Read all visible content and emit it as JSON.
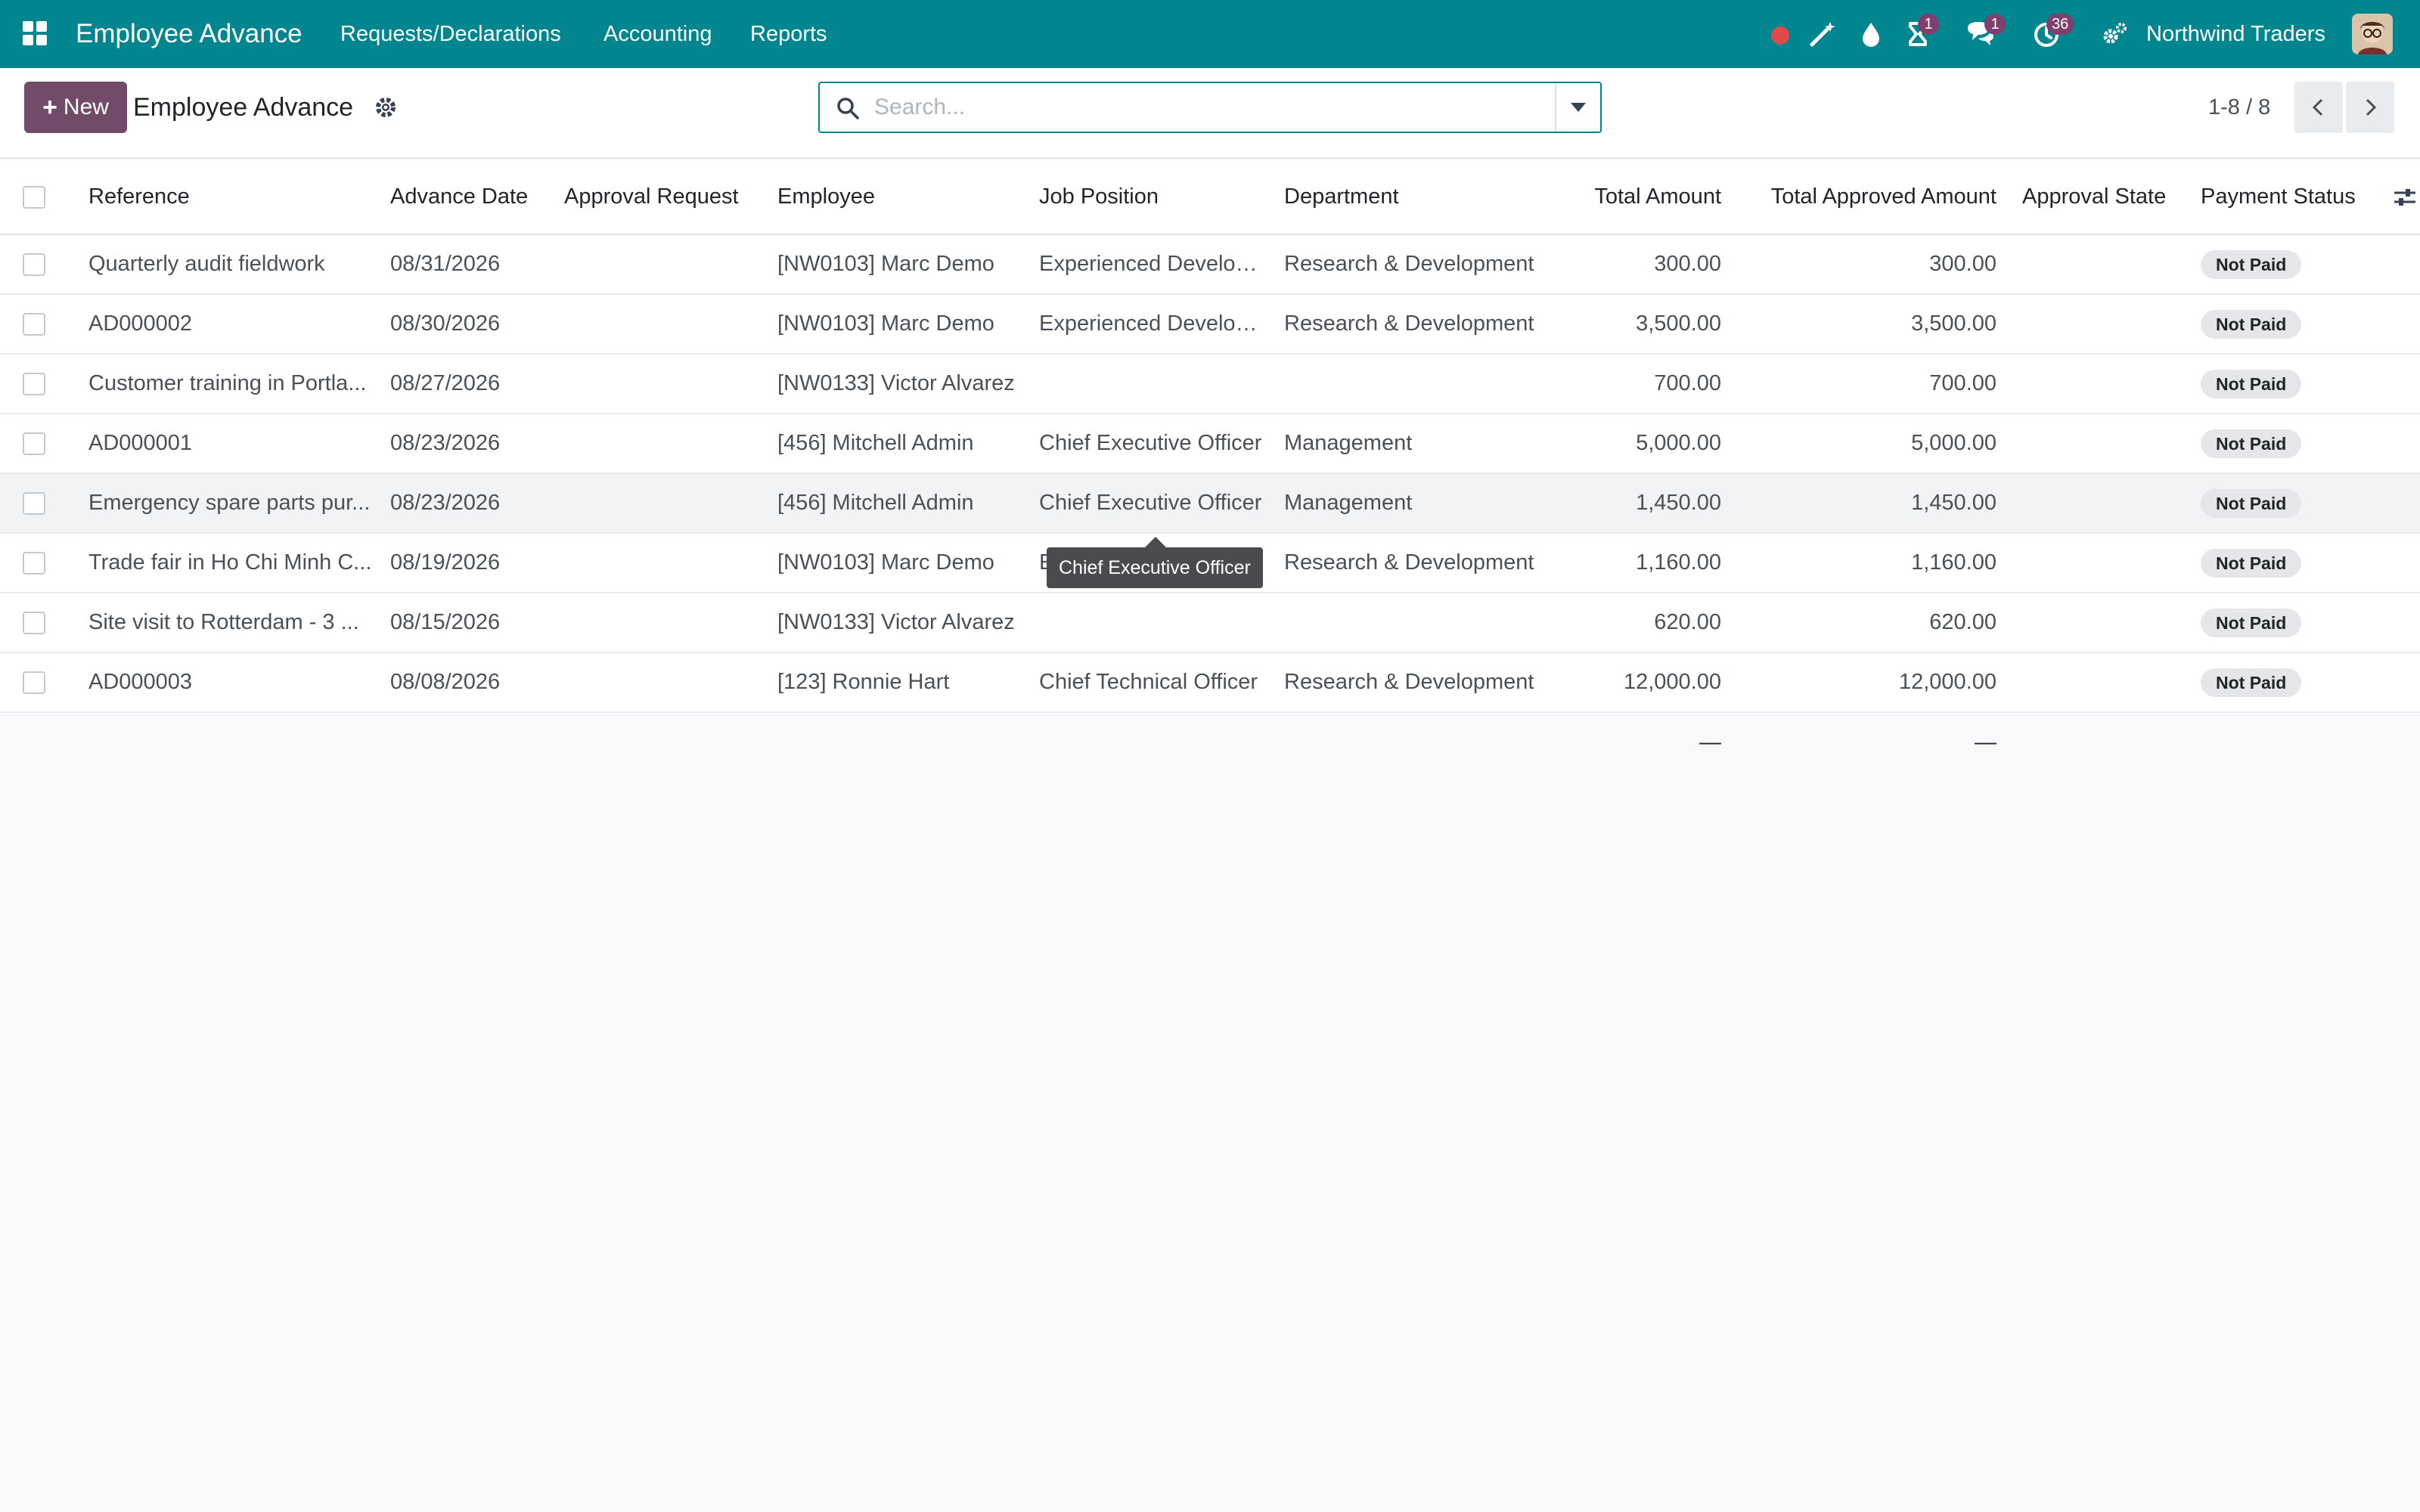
{
  "navbar": {
    "app_title": "Employee Advance",
    "menu": [
      "Requests/Declarations",
      "Accounting",
      "Reports"
    ],
    "activity_badge": "1",
    "messages_badge": "1",
    "clock_badge": "36",
    "company": "Northwind Traders",
    "bg_color": "#01858f"
  },
  "control_panel": {
    "new_label": "New",
    "title": "Employee Advance",
    "search_placeholder": "Search...",
    "pager": "1-8 / 8",
    "accent_color": "#714b67"
  },
  "table": {
    "columns": [
      "Reference",
      "Advance Date",
      "Approval Request",
      "Employee",
      "Job Position",
      "Department",
      "Total Amount",
      "Total Approved Amount",
      "Approval State",
      "Payment Status"
    ],
    "rows": [
      {
        "reference": "Quarterly audit fieldwork",
        "date": "08/31/2026",
        "approval_request": "",
        "employee": "[NW0103] Marc Demo",
        "job": "Experienced Developer",
        "department": "Research & Development",
        "total": "300.00",
        "approved": "300.00",
        "state": "",
        "payment": "Not Paid"
      },
      {
        "reference": "AD000002",
        "date": "08/30/2026",
        "approval_request": "",
        "employee": "[NW0103] Marc Demo",
        "job": "Experienced Developer",
        "department": "Research & Development",
        "total": "3,500.00",
        "approved": "3,500.00",
        "state": "",
        "payment": "Not Paid"
      },
      {
        "reference": "Customer training in Portla...",
        "date": "08/27/2026",
        "approval_request": "",
        "employee": "[NW0133] Victor Alvarez",
        "job": "",
        "department": "",
        "total": "700.00",
        "approved": "700.00",
        "state": "",
        "payment": "Not Paid"
      },
      {
        "reference": "AD000001",
        "date": "08/23/2026",
        "approval_request": "",
        "employee": "[456] Mitchell Admin",
        "job": "Chief Executive Officer",
        "department": "Management",
        "total": "5,000.00",
        "approved": "5,000.00",
        "state": "",
        "payment": "Not Paid"
      },
      {
        "reference": "Emergency spare parts pur...",
        "date": "08/23/2026",
        "approval_request": "",
        "employee": "[456] Mitchell Admin",
        "job": "Chief Executive Officer",
        "department": "Management",
        "total": "1,450.00",
        "approved": "1,450.00",
        "state": "",
        "payment": "Not Paid"
      },
      {
        "reference": "Trade fair in Ho Chi Minh C...",
        "date": "08/19/2026",
        "approval_request": "",
        "employee": "[NW0103] Marc Demo",
        "job": "Experienced Developer",
        "department": "Research & Development",
        "total": "1,160.00",
        "approved": "1,160.00",
        "state": "",
        "payment": "Not Paid"
      },
      {
        "reference": "Site visit to Rotterdam - 3 ...",
        "date": "08/15/2026",
        "approval_request": "",
        "employee": "[NW0133] Victor Alvarez",
        "job": "",
        "department": "",
        "total": "620.00",
        "approved": "620.00",
        "state": "",
        "payment": "Not Paid"
      },
      {
        "reference": "AD000003",
        "date": "08/08/2026",
        "approval_request": "",
        "employee": "[123] Ronnie Hart",
        "job": "Chief Technical Officer",
        "department": "Research & Development",
        "total": "12,000.00",
        "approved": "12,000.00",
        "state": "",
        "payment": "Not Paid"
      }
    ],
    "footer_total": "—",
    "footer_approved": "—"
  },
  "tooltip": {
    "text": "Chief Executive Officer"
  }
}
